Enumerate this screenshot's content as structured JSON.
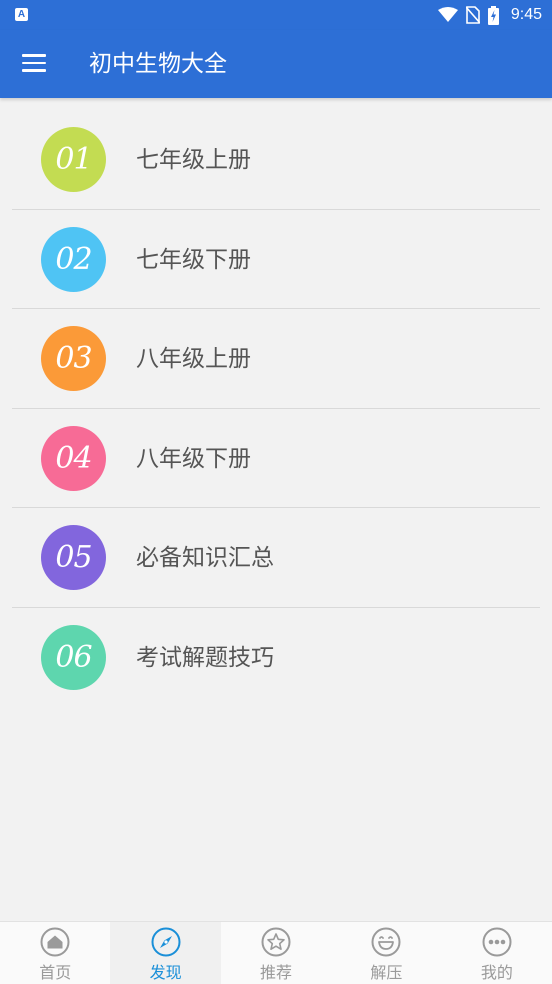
{
  "status_bar": {
    "notification_icon_letter": "A",
    "time": "9:45",
    "icons": [
      "wifi-icon",
      "no-sim-icon",
      "battery-charging-icon"
    ]
  },
  "app_bar": {
    "title": "初中生物大全",
    "menu_icon": "menu-icon",
    "color": "#2d6fd6"
  },
  "list": {
    "items": [
      {
        "number": "01",
        "label": "七年级上册",
        "color": "#c3dc52"
      },
      {
        "number": "02",
        "label": "七年级下册",
        "color": "#4fc4f4"
      },
      {
        "number": "03",
        "label": "八年级上册",
        "color": "#fb9a38"
      },
      {
        "number": "04",
        "label": "八年级下册",
        "color": "#f76b96"
      },
      {
        "number": "05",
        "label": "必备知识汇总",
        "color": "#8266dd"
      },
      {
        "number": "06",
        "label": "考试解题技巧",
        "color": "#5ed6ae"
      }
    ]
  },
  "bottom_nav": {
    "active_color": "#1a8fd8",
    "inactive_color": "#9a9a9a",
    "items": [
      {
        "label": "首页",
        "icon": "home-icon",
        "active": false
      },
      {
        "label": "发现",
        "icon": "compass-icon",
        "active": true
      },
      {
        "label": "推荐",
        "icon": "star-icon",
        "active": false
      },
      {
        "label": "解压",
        "icon": "laugh-icon",
        "active": false
      },
      {
        "label": "我的",
        "icon": "more-dots-icon",
        "active": false
      }
    ]
  }
}
